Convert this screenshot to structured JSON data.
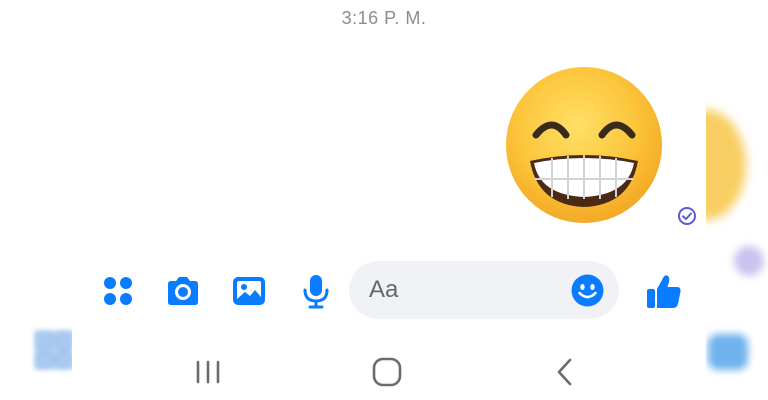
{
  "conversation": {
    "timestamp": "3:16 P. M.",
    "last_message": {
      "type": "emoji",
      "emoji": "grinning-face-with-smiling-eyes",
      "status": "sent"
    }
  },
  "composer": {
    "placeholder": "Aa",
    "actions": [
      "menu-grid-icon",
      "camera-icon",
      "gallery-icon",
      "microphone-icon"
    ],
    "emoji_button": "smiley-icon",
    "send_button": "thumbs-up-icon",
    "accent_color": "#0a7cff"
  },
  "system_nav": {
    "buttons": [
      "recents-icon",
      "home-icon",
      "back-icon"
    ],
    "color": "#6b6b6b"
  }
}
